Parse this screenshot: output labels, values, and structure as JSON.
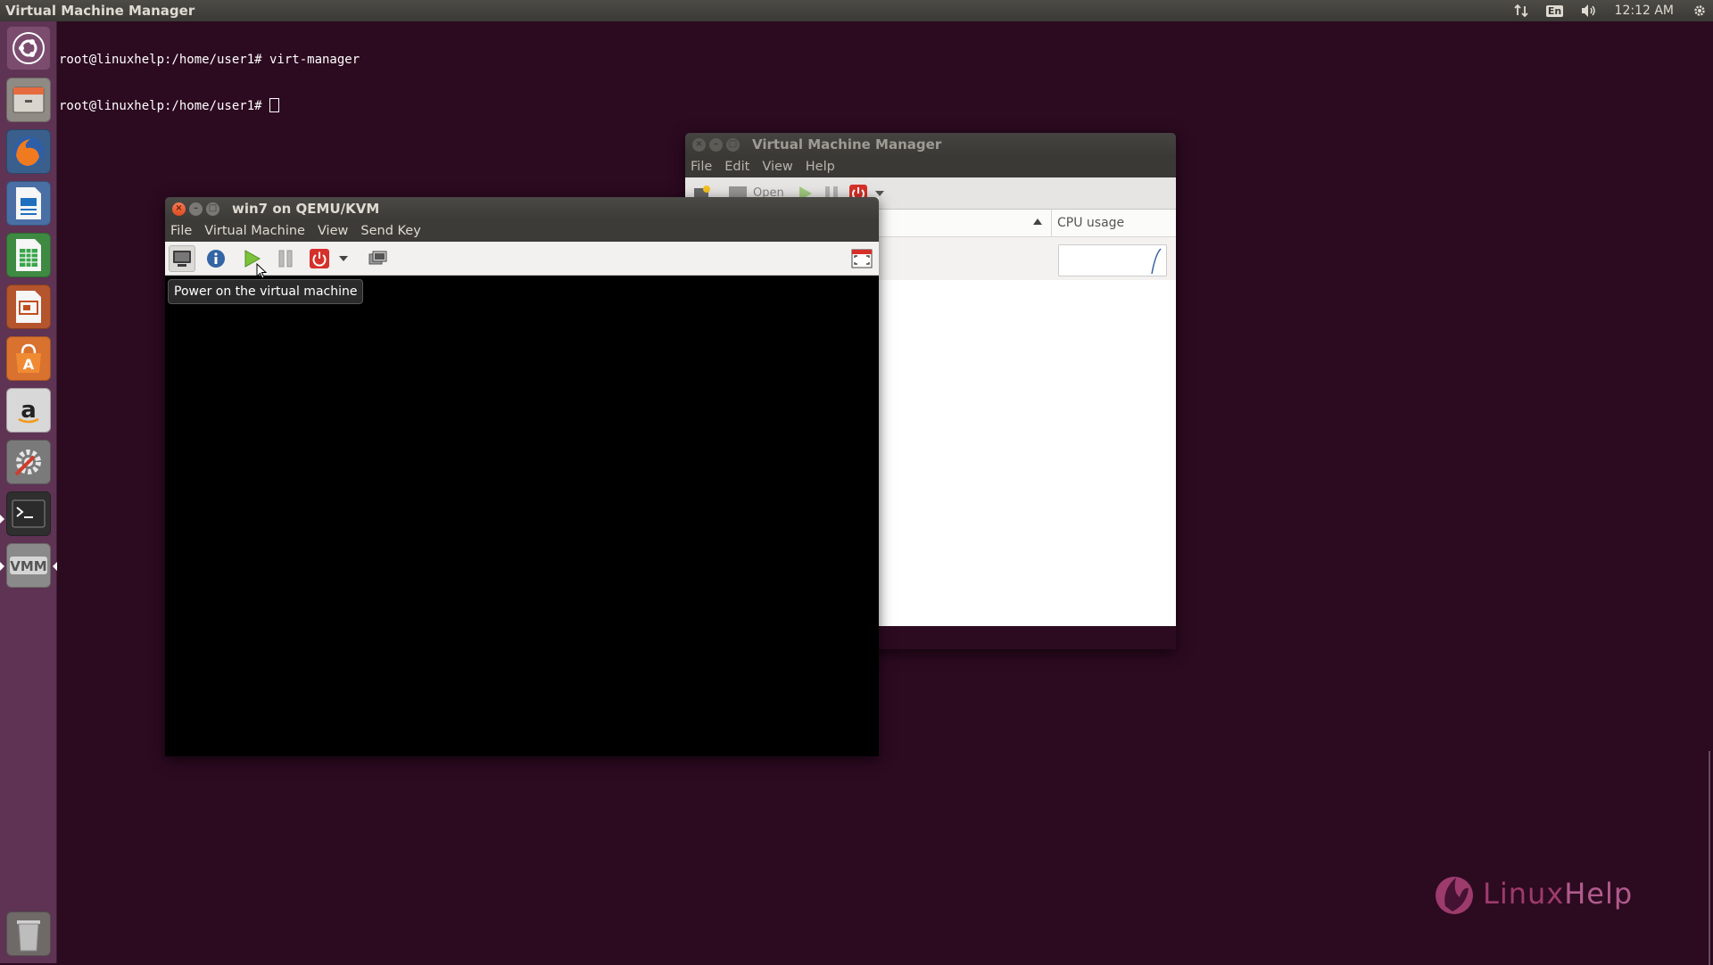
{
  "panel": {
    "title": "Virtual Machine Manager",
    "lang": "En",
    "clock": "12:12 AM",
    "icons": [
      "network-icon",
      "keyboard-layout-icon",
      "volume-icon",
      "gear-icon"
    ]
  },
  "launcher": {
    "items": [
      "ubuntu-dash-icon",
      "files-icon",
      "firefox-icon",
      "writer-icon",
      "calc-icon",
      "impress-icon",
      "software-center-icon",
      "amazon-icon",
      "system-settings-icon",
      "terminal-icon",
      "virt-manager-icon",
      "trash-icon"
    ]
  },
  "terminal": {
    "line1": "root@linuxhelp:/home/user1# virt-manager",
    "line2": "root@linuxhelp:/home/user1# "
  },
  "vmm_window": {
    "title": "Virtual Machine Manager",
    "menu": [
      "File",
      "Edit",
      "View",
      "Help"
    ],
    "toolbar_open_label": "Open",
    "column_cpu": "CPU usage"
  },
  "win7_window": {
    "title": "win7 on QEMU/KVM",
    "menu": [
      "File",
      "Virtual Machine",
      "View",
      "Send Key"
    ],
    "tooltip": "Power on the virtual machine"
  },
  "watermark": {
    "part1": "Linux",
    "part2": "Help"
  },
  "colors": {
    "desktop": "#2c0a20",
    "launcher": "#5e3353",
    "close_button": "#e04b1f",
    "accent_green": "#6ab42f",
    "power_red": "#d6302a"
  }
}
